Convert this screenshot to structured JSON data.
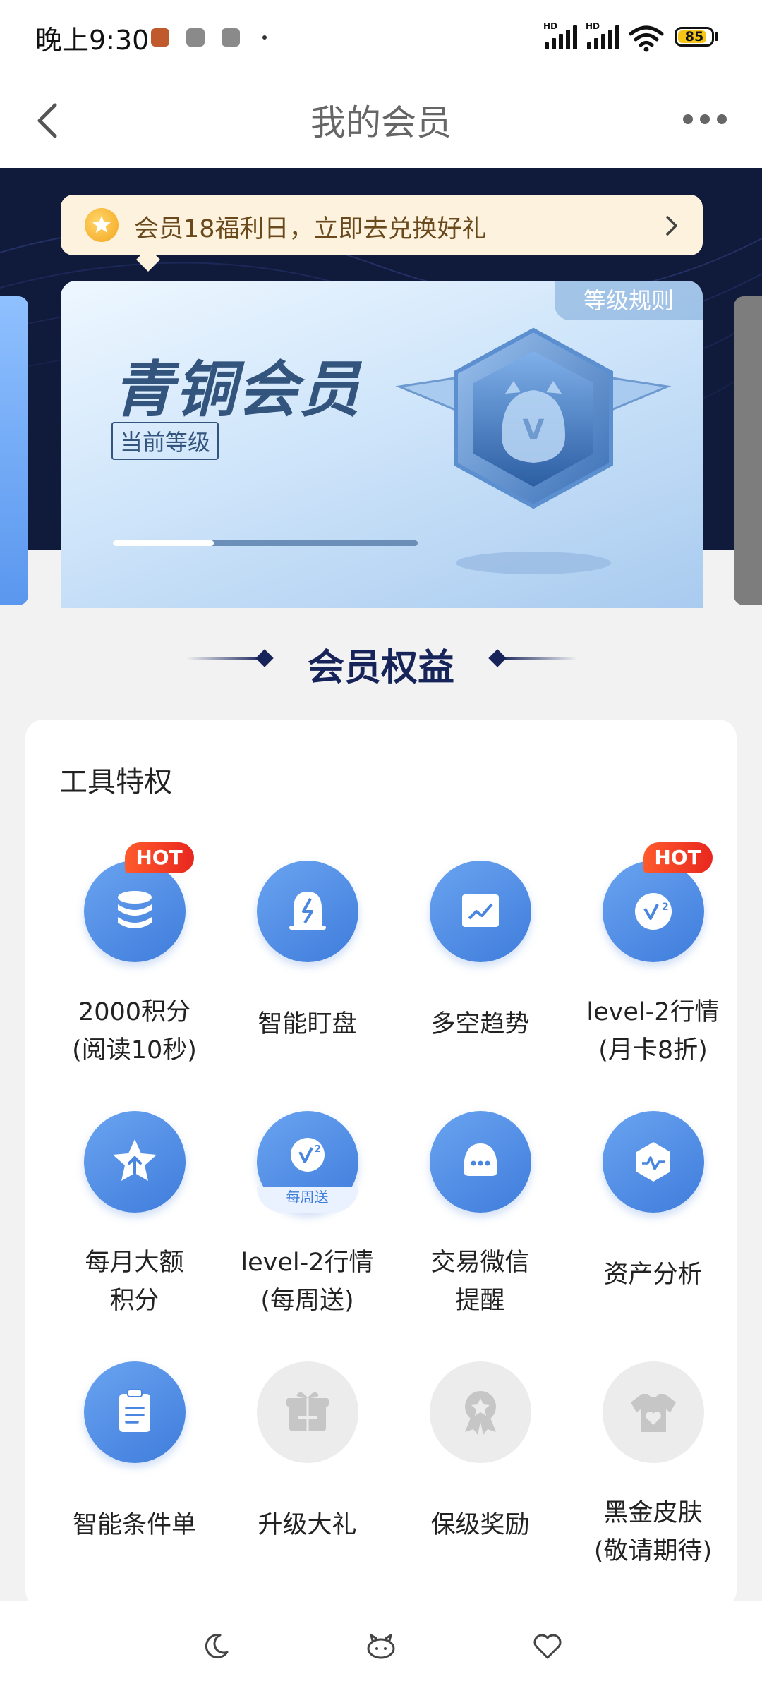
{
  "status_bar": {
    "time": "晚上9:30",
    "battery": "85",
    "icons": [
      "app-notification-icon",
      "wechat-icon",
      "lock-icon",
      "dot-icon",
      "hd-signal-icon",
      "hd-signal-icon",
      "wifi-icon",
      "battery-icon"
    ]
  },
  "header": {
    "title": "我的会员",
    "back_icon": "chevron-left-icon",
    "more_icon": "more-dots-icon"
  },
  "banner": {
    "text": "会员18福利日，立即去兑换好礼",
    "icon": "star-coin-icon"
  },
  "level_card": {
    "rule_label": "等级规则",
    "level_name": "青铜会员",
    "current_tag": "当前等级",
    "progress": 0.33,
    "badge_icon": "bronze-owl-badge-icon"
  },
  "section": {
    "title": "会员权益"
  },
  "tools": {
    "title": "工具特权",
    "hot_label": "HOT",
    "weekly_label": "每周送",
    "items": [
      {
        "label": "2000积分\n(阅读10秒)",
        "icon": "coins-stack-icon",
        "hot": true,
        "enabled": true
      },
      {
        "label": "智能盯盘",
        "icon": "bell-lightning-icon",
        "hot": false,
        "enabled": true
      },
      {
        "label": "多空趋势",
        "icon": "trend-board-icon",
        "hot": false,
        "enabled": true
      },
      {
        "label": "level-2行情\n(月卡8折)",
        "icon": "level2-v2-icon",
        "hot": true,
        "enabled": true
      },
      {
        "label": "每月大额\n积分",
        "icon": "star-arrow-up-icon",
        "hot": false,
        "enabled": true
      },
      {
        "label": "level-2行情\n(每周送)",
        "icon": "level2-weekly-icon",
        "hot": false,
        "enabled": true
      },
      {
        "label": "交易微信\n提醒",
        "icon": "chat-bubble-icon",
        "hot": false,
        "enabled": true
      },
      {
        "label": "资产分析",
        "icon": "hexagon-pulse-icon",
        "hot": false,
        "enabled": true
      },
      {
        "label": "智能条件单",
        "icon": "clipboard-icon",
        "hot": false,
        "enabled": true
      },
      {
        "label": "升级大礼",
        "icon": "gift-icon",
        "hot": false,
        "enabled": false
      },
      {
        "label": "保级奖励",
        "icon": "award-medal-icon",
        "hot": false,
        "enabled": false
      },
      {
        "label": "黑金皮肤\n(敬请期待)",
        "icon": "tshirt-heart-icon",
        "hot": false,
        "enabled": false
      }
    ]
  },
  "bottom_nav": {
    "icons": [
      "moon-icon",
      "pig-icon",
      "heart-icon"
    ]
  }
}
